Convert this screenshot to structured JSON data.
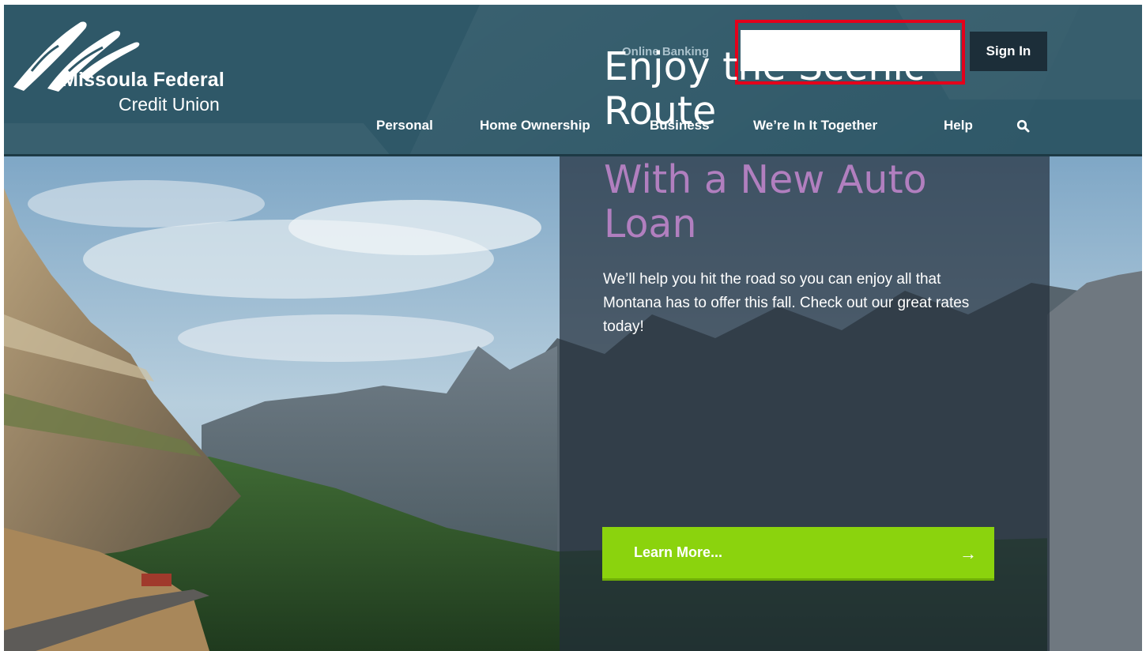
{
  "brand": {
    "name": "Missoula Federal",
    "subtitle": "Credit Union"
  },
  "login": {
    "label": "Online Banking",
    "input_value": "",
    "sign_in_label": "Sign In"
  },
  "nav": {
    "items": [
      {
        "label": "Personal"
      },
      {
        "label": "Home Ownership"
      },
      {
        "label": "Business"
      },
      {
        "label": "We’re In It Together"
      },
      {
        "label": "Help"
      }
    ],
    "search_icon": "search-icon"
  },
  "hero": {
    "headline_line1": "Enjoy the Scenic",
    "headline_line2": "Route",
    "subheadline_line1": "With a New Auto",
    "subheadline_line2": "Loan",
    "body": "We’ll help you hit the road so you can enjoy all that Montana has to offer this fall. Check out our great rates today!",
    "cta_label": "Learn More...",
    "cta_arrow": "→"
  },
  "colors": {
    "header_bg": "#2f5868",
    "sign_in_bg": "#1c2e39",
    "highlight_border": "#e3001b",
    "accent_purple": "#b17fbf",
    "cta_green": "#8bd30d"
  }
}
